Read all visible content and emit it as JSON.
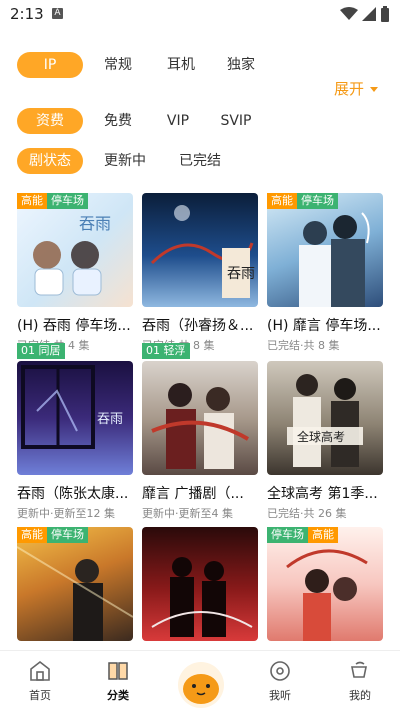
{
  "status": {
    "time": "2:13",
    "notif_icon": "A"
  },
  "filters": {
    "row1": [
      "IP",
      "常规",
      "耳机",
      "独家"
    ],
    "row2": [
      "资费",
      "免费",
      "VIP",
      "SVIP"
    ],
    "row3": [
      "剧状态",
      "更新中",
      "已完结"
    ],
    "expand_label": "展开",
    "active_color": "#FFA726"
  },
  "cards": [
    {
      "title": "(H) 吞雨 停车场...",
      "meta": "已完结·共 4 集",
      "badges": [
        "高能",
        "停车场"
      ],
      "ep_badge": ""
    },
    {
      "title": "吞雨（孙睿扬＆...",
      "meta": "已完结·共 8 集",
      "badges": [],
      "ep_badge": ""
    },
    {
      "title": "(H) 靡言 停车场...",
      "meta": "已完结·共 8 集",
      "badges": [
        "高能",
        "停车场"
      ],
      "ep_badge": ""
    },
    {
      "title": "吞雨（陈张太康...",
      "meta": "更新中·更新至12 集",
      "badges": [],
      "ep_badge": "01 同居"
    },
    {
      "title": "靡言 广播剧（...",
      "meta": "更新中·更新至4 集",
      "badges": [],
      "ep_badge": "01 轻浮"
    },
    {
      "title": "全球高考 第1季...",
      "meta": "已完结·共 26 集",
      "badges": [],
      "ep_badge": ""
    },
    {
      "title": "",
      "meta": "",
      "badges": [
        "高能",
        "停车场"
      ],
      "ep_badge": ""
    },
    {
      "title": "",
      "meta": "",
      "badges": [],
      "ep_badge": ""
    },
    {
      "title": "",
      "meta": "",
      "badges": [
        "停车场",
        "高能"
      ],
      "ep_badge": ""
    }
  ],
  "tabbar": {
    "tabs": [
      {
        "label": "首页",
        "icon": "home-icon"
      },
      {
        "label": "分类",
        "icon": "category-book-icon"
      },
      {
        "label": "我听",
        "icon": "listen-disc-icon"
      },
      {
        "label": "我的",
        "icon": "profile-cup-icon"
      }
    ],
    "active_index": 1
  }
}
